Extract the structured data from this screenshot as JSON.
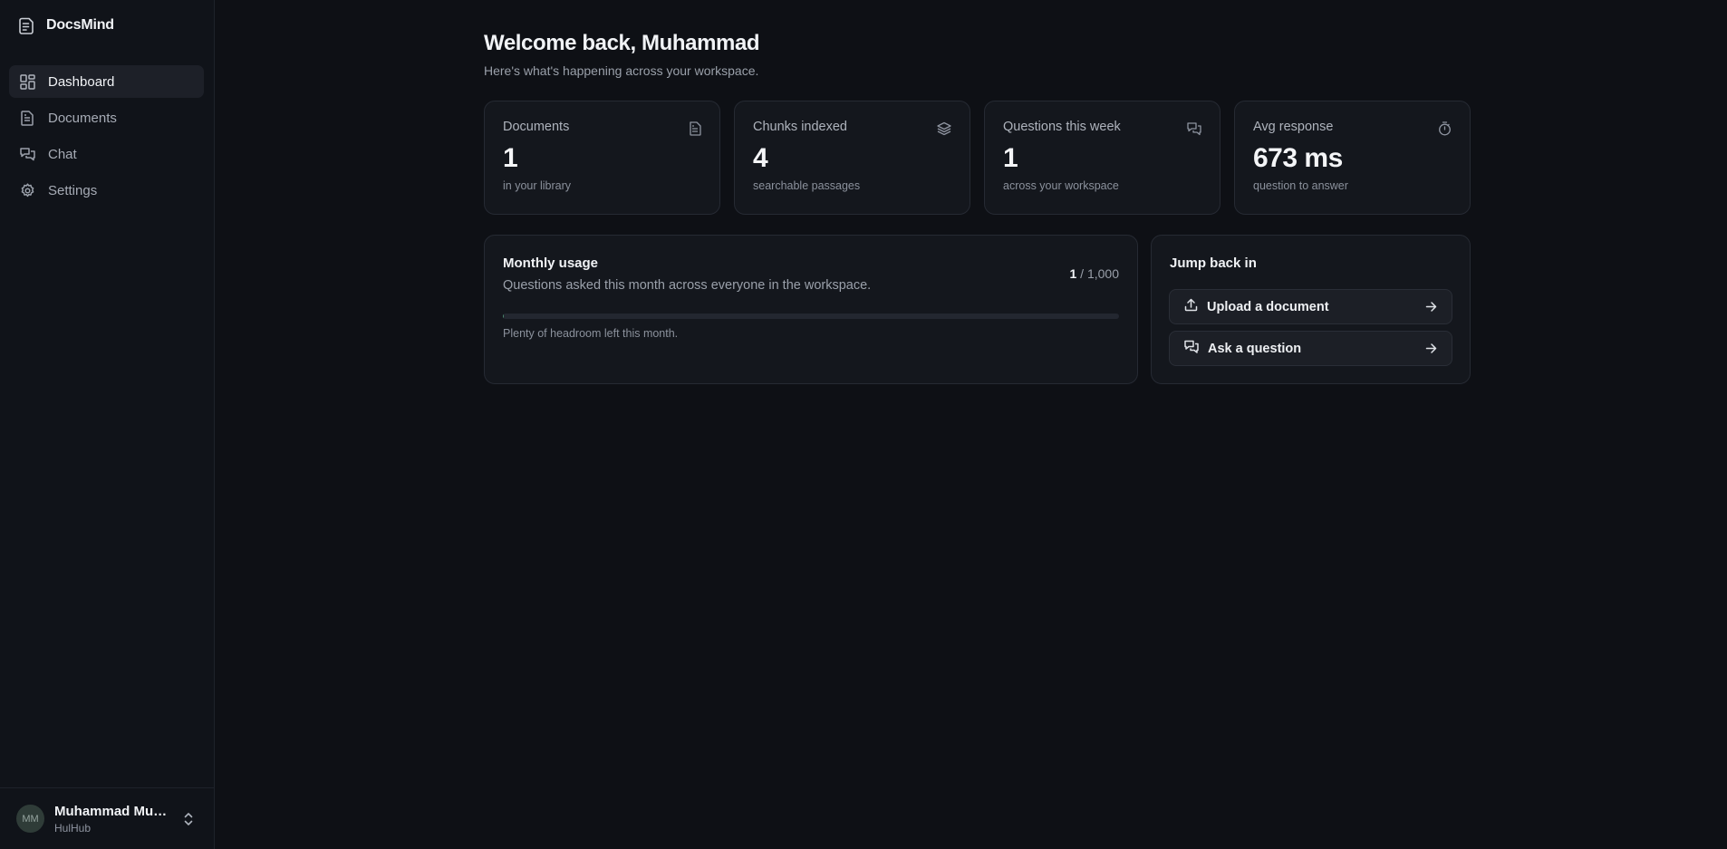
{
  "app": {
    "name": "DocsMind"
  },
  "sidebar": {
    "items": [
      {
        "label": "Dashboard",
        "icon": "dashboard-icon",
        "active": true
      },
      {
        "label": "Documents",
        "icon": "document-icon",
        "active": false
      },
      {
        "label": "Chat",
        "icon": "chat-icon",
        "active": false
      },
      {
        "label": "Settings",
        "icon": "gear-icon",
        "active": false
      }
    ]
  },
  "user": {
    "initials": "MM",
    "name": "Muhammad Mun...",
    "org": "HulHub"
  },
  "header": {
    "title": "Welcome back, Muhammad",
    "subtitle": "Here's what's happening across your workspace."
  },
  "stats": [
    {
      "label": "Documents",
      "value": "1",
      "hint": "in your library",
      "icon": "document-icon"
    },
    {
      "label": "Chunks indexed",
      "value": "4",
      "hint": "searchable passages",
      "icon": "layers-icon"
    },
    {
      "label": "Questions this week",
      "value": "1",
      "hint": "across your workspace",
      "icon": "chat-icon"
    },
    {
      "label": "Avg response",
      "value": "673 ms",
      "hint": "question to answer",
      "icon": "timer-icon"
    }
  ],
  "usage": {
    "title": "Monthly usage",
    "description": "Questions asked this month across everyone in the workspace.",
    "used": "1",
    "limit": "/ 1,000",
    "fraction": 0.001,
    "note": "Plenty of headroom left this month."
  },
  "jump": {
    "title": "Jump back in",
    "upload_label": "Upload a document",
    "ask_label": "Ask a question"
  },
  "colors": {
    "background": "#0e1015",
    "card": "#14171d",
    "accent": "#4b8a6f"
  }
}
